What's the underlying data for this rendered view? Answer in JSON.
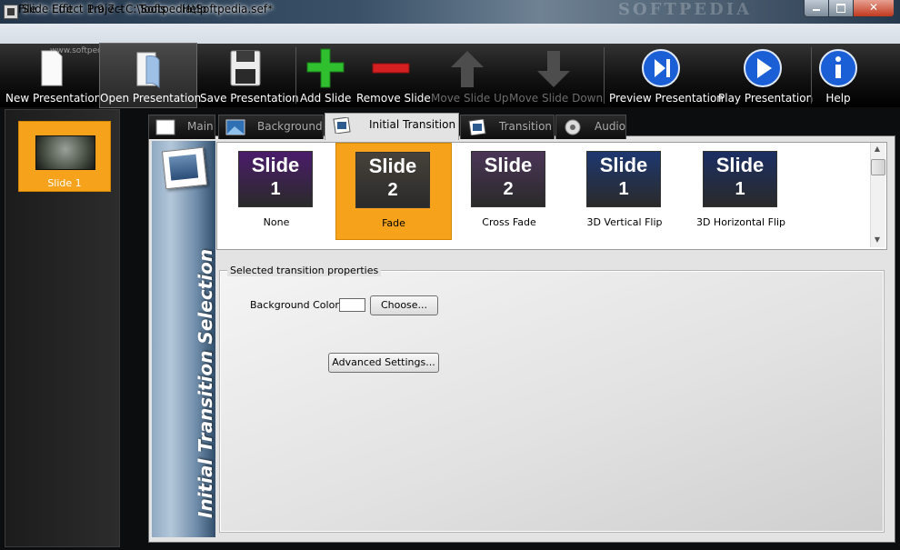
{
  "window": {
    "title": "Slide Effect 1.9.7 - C:\\Softpedia\\Softpedia.sef*",
    "watermark": "SOFTPEDIA",
    "watermark_small": "www.softpedia.com"
  },
  "menu": [
    "File",
    "Edit",
    "Project",
    "Tools",
    "Help"
  ],
  "toolbar": {
    "new": "New Presentation",
    "open": "Open Presentation",
    "save": "Save Presentation",
    "add": "Add Slide",
    "remove": "Remove Slide",
    "move_up": "Move Slide Up",
    "move_down": "Move Slide Down",
    "preview": "Preview Presentation",
    "play": "Play Presentation",
    "help": "Help"
  },
  "slides": [
    {
      "label": "Slide 1",
      "selected": true
    }
  ],
  "tabs": [
    {
      "label": "Main",
      "icon": "window-icon"
    },
    {
      "label": "Background",
      "icon": "picture-icon"
    },
    {
      "label": "Initial Transition",
      "icon": "slide-picture-icon",
      "active": true
    },
    {
      "label": "Transition",
      "icon": "slide-picture-icon"
    },
    {
      "label": "Audio",
      "icon": "speaker-icon"
    }
  ],
  "side_banner": "Initial Transition Selection",
  "transitions": [
    {
      "label": "None",
      "thumb_word": "Slide",
      "thumb_num": "1",
      "bg": "#4b1c6b"
    },
    {
      "label": "Fade",
      "thumb_word": "Slide",
      "thumb_num": "2",
      "bg": "#47423a",
      "selected": true
    },
    {
      "label": "Cross Fade",
      "thumb_word": "Slide",
      "thumb_num": "2",
      "bg": "#4b3557"
    },
    {
      "label": "3D Vertical Flip",
      "thumb_word": "Slide",
      "thumb_num": "1",
      "bg": "#1e3870"
    },
    {
      "label": "3D Horizontal Flip",
      "thumb_word": "Slide",
      "thumb_num": "1",
      "bg": "#1c2f63"
    }
  ],
  "properties": {
    "group_title": "Selected transition properties",
    "background_color_label": "Background Color:",
    "background_color_value": "#ffffff",
    "choose_button": "Choose...",
    "advanced_button": "Advanced Settings..."
  },
  "colors": {
    "accent_orange": "#f6a21a",
    "add_green": "#2fbf2f",
    "remove_red": "#d42020",
    "play_blue": "#1a5fd6"
  }
}
